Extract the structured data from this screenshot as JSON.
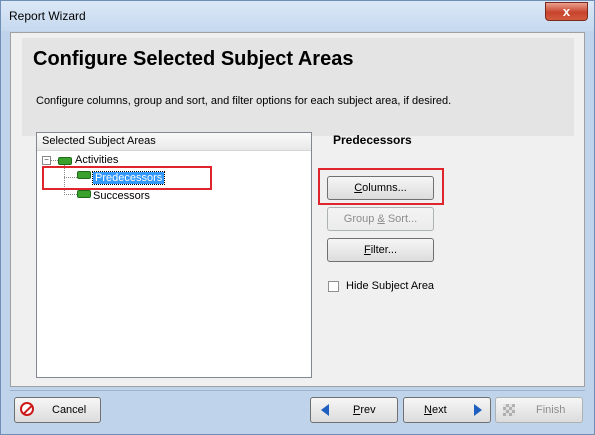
{
  "window": {
    "title": "Report Wizard",
    "close_label": "x"
  },
  "page": {
    "title": "Configure Selected Subject Areas",
    "description": "Configure columns, group and sort, and filter options for each subject area, if desired."
  },
  "tree": {
    "header": "Selected Subject Areas",
    "root": {
      "expander": "−",
      "label": "Activities"
    },
    "children": [
      {
        "label": "Predecessors",
        "selected": true
      },
      {
        "label": "Successors",
        "selected": false
      }
    ]
  },
  "detail": {
    "section_title": "Predecessors",
    "columns_button": {
      "mnemonic": "C",
      "rest": "olumns..."
    },
    "group_sort_button": {
      "prefix": "Group ",
      "mnemonic": "&",
      "rest": " Sort..."
    },
    "filter_button": {
      "mnemonic": "F",
      "rest": "ilter..."
    },
    "hide_checkbox": {
      "label": "Hide Subject Area",
      "checked": false
    }
  },
  "footer": {
    "cancel": "Cancel",
    "prev": {
      "mnemonic": "P",
      "rest": "rev"
    },
    "next": {
      "mnemonic": "N",
      "rest": "ext"
    },
    "finish": "Finish"
  },
  "colors": {
    "highlight": "#e0242c",
    "selection": "#3399ff",
    "node_icon": "#3aa12f"
  },
  "icons": [
    "close-icon",
    "cancel-icon",
    "prev-arrow-icon",
    "next-arrow-icon",
    "finish-flag-icon",
    "subject-area-node-icon"
  ]
}
